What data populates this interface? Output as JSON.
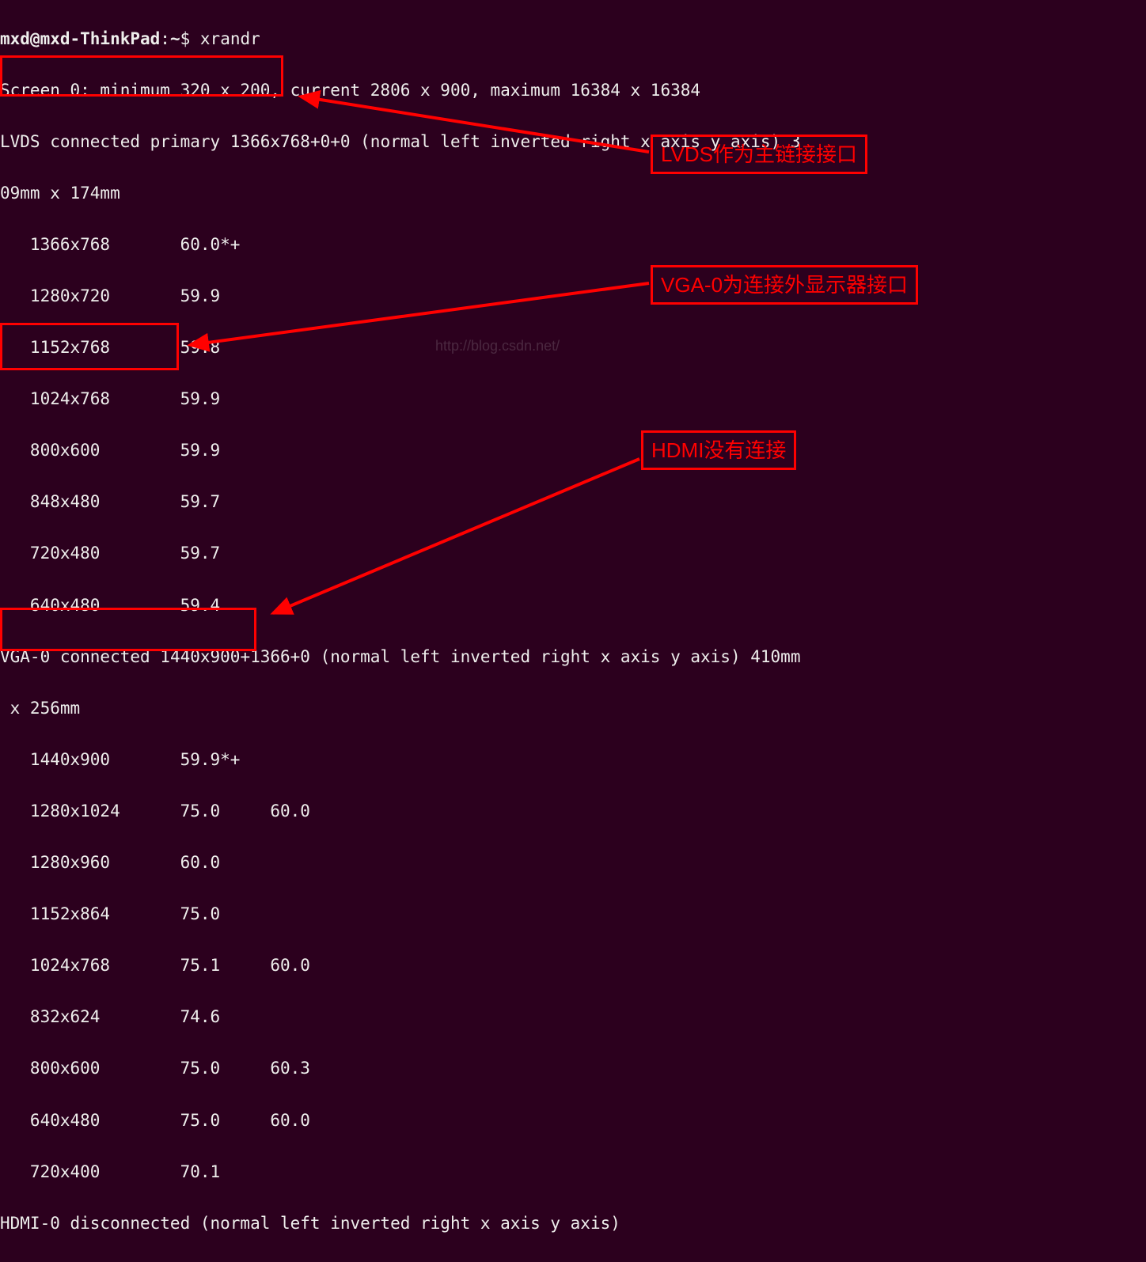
{
  "prompt": {
    "user_host": "mxd@mxd-ThinkPad",
    "sep1": ":",
    "path": "~",
    "sep2": "$ ",
    "command": "xrandr"
  },
  "screen_line": "Screen 0: minimum 320 x 200, current 2806 x 900, maximum 16384 x 16384",
  "lvds": {
    "header_1": "LVDS connected primary",
    "header_2": " 1366x768+0+0 (normal left inverted right x axis y axis) 3",
    "wrap": "09mm x 174mm",
    "modes": [
      "   1366x768       60.0*+",
      "   1280x720       59.9  ",
      "   1152x768       59.8  ",
      "   1024x768       59.9  ",
      "   800x600        59.9  ",
      "   848x480        59.7  ",
      "   720x480        59.7  ",
      "   640x480        59.4  "
    ]
  },
  "vga": {
    "header_1": "VGA-0 connected",
    "header_2": " 1440x900+1366+0 (normal left inverted right x axis y axis) 410mm",
    "wrap": " x 256mm",
    "modes": [
      "   1440x900       59.9*+",
      "   1280x1024      75.0     60.0  ",
      "   1280x960       60.0  ",
      "   1152x864       75.0  ",
      "   1024x768       75.1     60.0  ",
      "   832x624        74.6  ",
      "   800x600        75.0     60.3  ",
      "   640x480        75.0     60.0  ",
      "   720x400        70.1  "
    ]
  },
  "hdmi": {
    "header_1": "HDMI-0 disconnected",
    "header_2": " (normal left inverted right x axis y axis)"
  },
  "callouts": {
    "lvds": "LVDS作为主链接接口",
    "vga": "VGA-0为连接外显示器接口",
    "hdmi": "HDMI没有连接"
  },
  "watermark": "http://blog.csdn.net/"
}
